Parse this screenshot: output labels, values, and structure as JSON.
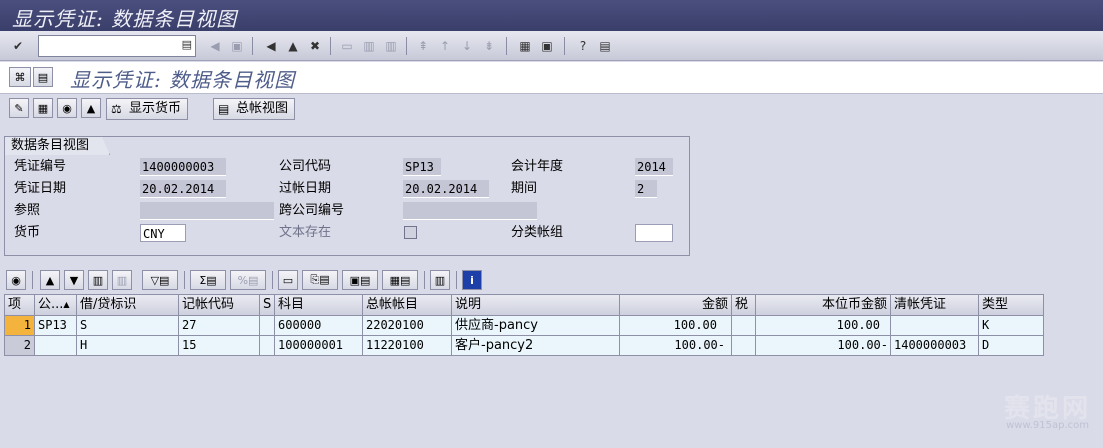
{
  "window": {
    "title": "显示凭证: 数据条目视图"
  },
  "screen": {
    "title": "显示凭证: 数据条目视图"
  },
  "std_toolbar": {
    "command_value": ""
  },
  "app_toolbar": {
    "display_currency_label": "显示货币",
    "gl_view_label": "总帐视图"
  },
  "header": {
    "group_title": "数据条目视图",
    "labels": {
      "doc_number": "凭证编号",
      "company_code": "公司代码",
      "fiscal_year": "会计年度",
      "doc_date": "凭证日期",
      "posting_date": "过帐日期",
      "period": "期间",
      "reference": "参照",
      "cross_company": "跨公司编号",
      "currency": "货币",
      "text_exists": "文本存在",
      "ledger_group": "分类帐组"
    },
    "values": {
      "doc_number": "1400000003",
      "company_code": "SP13",
      "fiscal_year": "2014",
      "doc_date": "20.02.2014",
      "posting_date": "20.02.2014",
      "period": "2",
      "reference": "",
      "cross_company": "",
      "currency": "CNY",
      "ledger_group": ""
    }
  },
  "table": {
    "columns": [
      "项",
      "公...",
      "借/贷标识",
      "记帐代码",
      "S",
      "科目",
      "总帐帐目",
      "说明",
      "金额",
      "税",
      "本位币金额",
      "清帐凭证",
      "类型"
    ],
    "rows": [
      [
        "1",
        "SP13",
        "S",
        "27",
        "",
        "600000",
        "22020100",
        "供应商-pancy",
        "100.00",
        "",
        "100.00",
        "",
        "K"
      ],
      [
        "2",
        "",
        "H",
        "15",
        "",
        "100000001",
        "11220100",
        "客户-pancy2",
        "100.00-",
        "",
        "100.00-",
        "1400000003",
        "D"
      ]
    ]
  },
  "watermark": {
    "text": "赛跑网",
    "url": "www.915ap.com"
  }
}
